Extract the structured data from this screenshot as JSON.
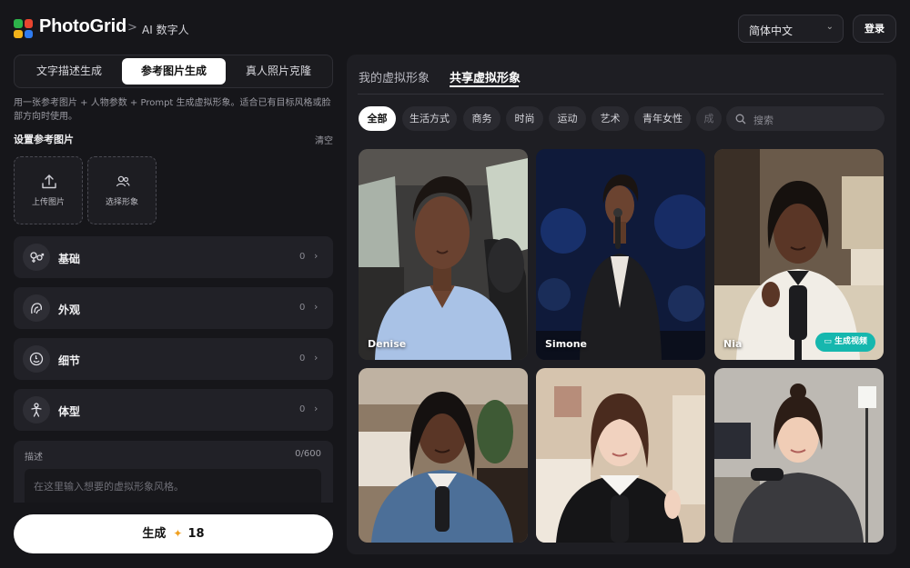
{
  "header": {
    "brand": "PhotoGrid",
    "crumb_sep": ">",
    "crumb": "AI 数字人",
    "language": "简体中文",
    "login": "登录",
    "colors": {
      "logo": [
        "#2db34a",
        "#e9452f",
        "#f2b21a",
        "#2f7bf0"
      ]
    }
  },
  "left": {
    "tabs": [
      {
        "label": "文字描述生成",
        "active": false
      },
      {
        "label": "参考图片生成",
        "active": true
      },
      {
        "label": "真人照片克隆",
        "active": false
      }
    ],
    "description": "用一张参考图片 + 人物参数 + Prompt 生成虚拟形象。适合已有目标风格或脸部方向时使用。",
    "ref_section": {
      "title": "设置参考图片",
      "clear": "清空"
    },
    "upload_buttons": [
      {
        "label": "上传图片",
        "icon": "upload-icon"
      },
      {
        "label": "选择形象",
        "icon": "people-icon"
      }
    ],
    "param_rows": [
      {
        "label": "基础",
        "count": "0",
        "icon": "gender-icon"
      },
      {
        "label": "外观",
        "count": "0",
        "icon": "hair-icon"
      },
      {
        "label": "细节",
        "count": "0",
        "icon": "face-icon"
      },
      {
        "label": "体型",
        "count": "0",
        "icon": "body-icon"
      }
    ],
    "prompt": {
      "label": "描述",
      "counter": "0/600",
      "placeholder": "在这里输入想要的虚拟形象风格。"
    },
    "generate": {
      "label": "生成",
      "cost": "18"
    }
  },
  "right": {
    "tabs": [
      {
        "label": "我的虚拟形象",
        "active": false
      },
      {
        "label": "共享虚拟形象",
        "active": true
      }
    ],
    "filters": [
      {
        "label": "全部",
        "active": true
      },
      {
        "label": "生活方式",
        "active": false
      },
      {
        "label": "商务",
        "active": false
      },
      {
        "label": "时尚",
        "active": false
      },
      {
        "label": "运动",
        "active": false
      },
      {
        "label": "艺术",
        "active": false
      },
      {
        "label": "青年女性",
        "active": false
      },
      {
        "label": "成",
        "active": false
      }
    ],
    "search_placeholder": "搜索",
    "avatars": [
      {
        "name": "Denise",
        "badge": ""
      },
      {
        "name": "Simone",
        "badge": ""
      },
      {
        "name": "Nia",
        "badge": "生成视频"
      },
      {
        "name": "",
        "badge": ""
      },
      {
        "name": "",
        "badge": ""
      },
      {
        "name": "",
        "badge": ""
      }
    ],
    "colors": {
      "video_badge": "#16b7ae"
    }
  }
}
